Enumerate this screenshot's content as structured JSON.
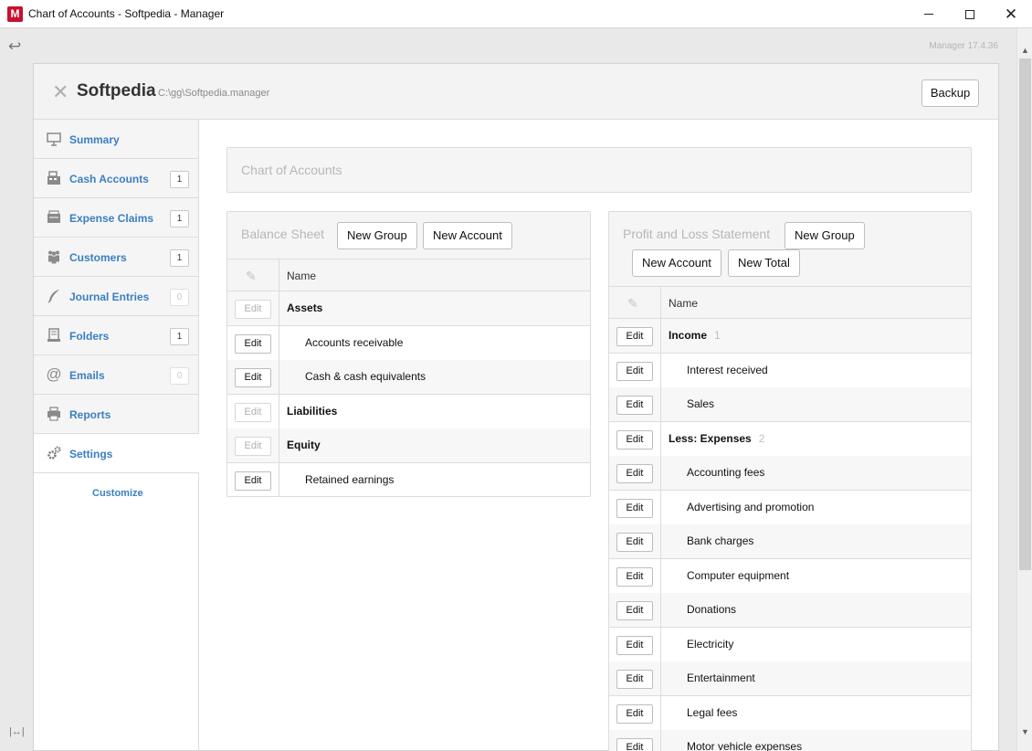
{
  "window": {
    "app_icon": "M",
    "title": "Chart of Accounts - Softpedia - Manager"
  },
  "version": "Manager 17.4.36",
  "business": {
    "name": "Softpedia",
    "path": "C:\\gg\\Softpedia.manager",
    "backup_label": "Backup"
  },
  "sidebar": {
    "items": [
      {
        "label": "Summary",
        "icon": "presentation-icon",
        "badge": ""
      },
      {
        "label": "Cash Accounts",
        "icon": "cash-register-icon",
        "badge": "1"
      },
      {
        "label": "Expense Claims",
        "icon": "wallet-icon",
        "badge": "1"
      },
      {
        "label": "Customers",
        "icon": "people-icon",
        "badge": "1"
      },
      {
        "label": "Journal Entries",
        "icon": "quill-icon",
        "badge": "0"
      },
      {
        "label": "Folders",
        "icon": "folder-stack-icon",
        "badge": "1"
      },
      {
        "label": "Emails",
        "icon": "at-icon",
        "badge": "0"
      },
      {
        "label": "Reports",
        "icon": "printer-icon",
        "badge": ""
      },
      {
        "label": "Settings",
        "icon": "gears-icon",
        "badge": ""
      }
    ],
    "customize_label": "Customize"
  },
  "page": {
    "title": "Chart of Accounts"
  },
  "balance_sheet": {
    "title": "Balance Sheet",
    "new_group_label": "New Group",
    "new_account_label": "New Account",
    "column_name": "Name",
    "edit_label": "Edit",
    "rows": [
      {
        "name": "Assets",
        "kind": "group"
      },
      {
        "name": "Accounts receivable",
        "kind": "child"
      },
      {
        "name": "Cash & cash equivalents",
        "kind": "child"
      },
      {
        "name": "Liabilities",
        "kind": "group"
      },
      {
        "name": "Equity",
        "kind": "group"
      },
      {
        "name": "Retained earnings",
        "kind": "child"
      }
    ]
  },
  "profit_loss": {
    "title": "Profit and Loss Statement",
    "new_group_label": "New Group",
    "new_account_label": "New Account",
    "new_total_label": "New Total",
    "column_name": "Name",
    "edit_label": "Edit",
    "rows": [
      {
        "name": "Income",
        "kind": "group",
        "count": "1"
      },
      {
        "name": "Interest received",
        "kind": "child"
      },
      {
        "name": "Sales",
        "kind": "child"
      },
      {
        "name": "Less: Expenses",
        "kind": "group",
        "count": "2"
      },
      {
        "name": "Accounting fees",
        "kind": "child"
      },
      {
        "name": "Advertising and promotion",
        "kind": "child"
      },
      {
        "name": "Bank charges",
        "kind": "child"
      },
      {
        "name": "Computer equipment",
        "kind": "child"
      },
      {
        "name": "Donations",
        "kind": "child"
      },
      {
        "name": "Electricity",
        "kind": "child"
      },
      {
        "name": "Entertainment",
        "kind": "child"
      },
      {
        "name": "Legal fees",
        "kind": "child"
      },
      {
        "name": "Motor vehicle expenses",
        "kind": "child"
      }
    ]
  }
}
